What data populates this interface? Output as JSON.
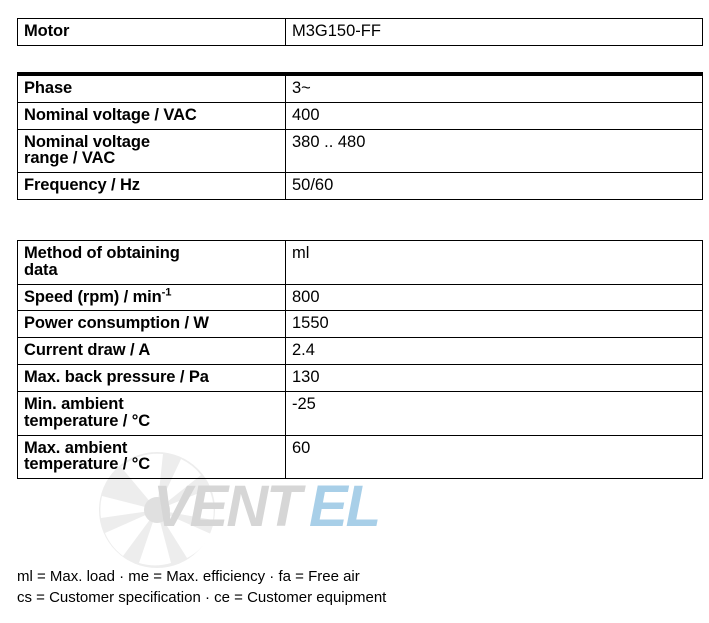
{
  "document": {
    "type": "motor-specification-table",
    "background_color": "#ffffff",
    "text_color": "#000000"
  },
  "identification": {
    "rows": [
      {
        "label": "Motor",
        "value": "M3G150-FF"
      }
    ]
  },
  "electrical": {
    "rows": [
      {
        "label": "Phase",
        "value": "3~"
      },
      {
        "label": "Nominal voltage / VAC",
        "value": "400"
      },
      {
        "label_line1": "Nominal voltage",
        "label_line2": "range / VAC",
        "value": "380 .. 480"
      },
      {
        "label": "Frequency / Hz",
        "value": "50/60"
      }
    ]
  },
  "performance": {
    "rows": [
      {
        "label_line1": "Method of obtaining",
        "label_line2": "data",
        "value": "ml"
      },
      {
        "label_prefix": "Speed (rpm) / min",
        "label_sup": "-1",
        "value": "800"
      },
      {
        "label": "Power consumption / W",
        "value": "1550"
      },
      {
        "label": "Current draw / A",
        "value": "2.4"
      },
      {
        "label": "Max. back pressure / Pa",
        "value": "130"
      },
      {
        "label_line1": "Min. ambient",
        "label_line2": "temperature / °C",
        "value": "-25"
      },
      {
        "label_line1": "Max. ambient",
        "label_line2": "temperature / °C",
        "value": "60"
      }
    ]
  },
  "footnotes": {
    "line1": "ml = Max. load · me = Max. efficiency · fa = Free air",
    "line2": "cs = Customer specification · ce = Customer equipment"
  },
  "watermark": {
    "text_primary": "VENT",
    "text_secondary": "EL",
    "color_primary": "#d4d4d4",
    "color_secondary": "#a8cfe8",
    "fan_color": "#e4e4e4"
  }
}
